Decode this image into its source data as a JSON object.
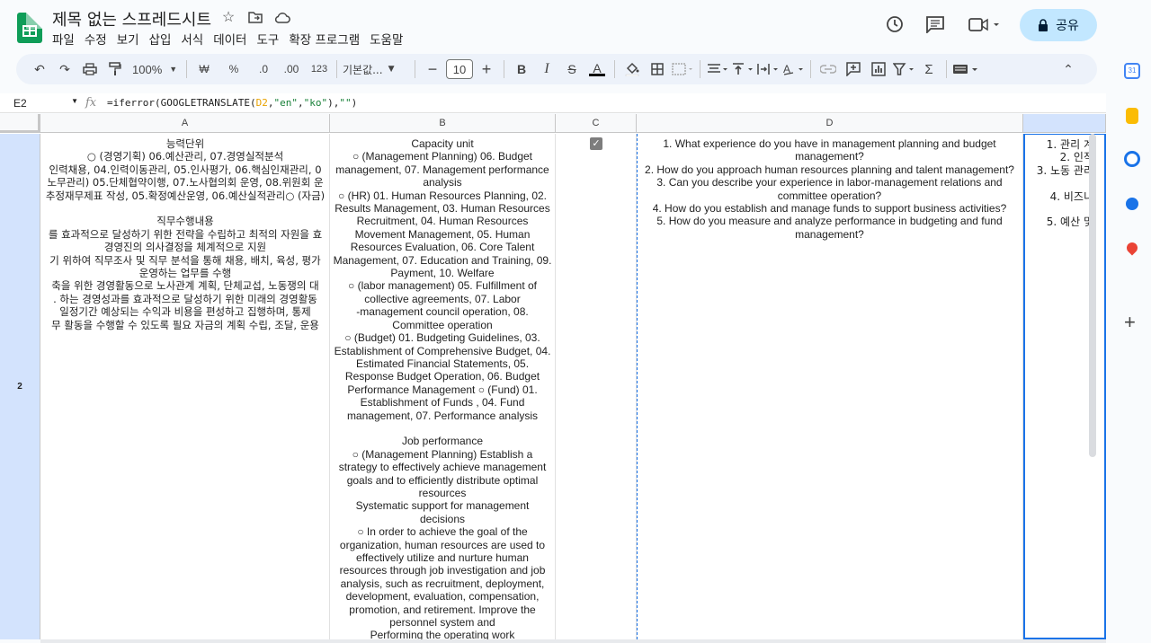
{
  "title": "제목 없는 스프레드시트",
  "menu": [
    "파일",
    "수정",
    "보기",
    "삽입",
    "서식",
    "데이터",
    "도구",
    "확장 프로그램",
    "도움말"
  ],
  "share_label": "공유",
  "toolbar": {
    "zoom": "100%",
    "currency": "₩",
    "percent": "%",
    "dec_decrease": ".0",
    "dec_increase": ".00",
    "more_formats": "123",
    "font": "기본값...",
    "font_size": "10"
  },
  "formula_bar": {
    "cell_ref": "E2",
    "fx": "fx",
    "formula_prefix": "=iferror(GOOGLETRANSLATE(",
    "formula_ref": "D2",
    "formula_mid1": ",",
    "formula_str1": "\"en\"",
    "formula_mid2": ",",
    "formula_str2": "\"ko\"",
    "formula_mid3": "),",
    "formula_str3": "\"\"",
    "formula_end": ")"
  },
  "columns": [
    "A",
    "B",
    "C",
    "D"
  ],
  "row_number": "2",
  "cell_a": [
    "능력단위",
    "○ (경영기획) 06.예산관리, 07.경영실적분석",
    "인력채용, 04.인력이동관리, 05.인사평가, 06.핵심인재관리, 0",
    "노무관리) 05.단체협약이행, 07.노사협의회 운영, 08.위원회 운",
    "추정재무제표 작성, 05.확정예산운영, 06.예산실적관리○ (자금)",
    "",
    "직무수행내용",
    "를 효과적으로 달성하기 위한 전략을 수립하고 최적의 자원을 효",
    "경영진의 의사결정을 체계적으로 지원",
    "기 위하여 직무조사 및 직무 분석을 통해 채용, 배치, 육성, 평가",
    "운영하는 업무를 수행",
    "축을 위한 경영활동으로 노사관계 계획, 단체교섭, 노동쟁의 대",
    ". 하는 경영성과를 효과적으로 달성하기 위한 미래의 경영활동",
    "일정기간 예상되는 수익과 비용을 편성하고 집행하며, 통제",
    "무 활동을 수행할 수 있도록 필요 자금의 계획 수립, 조달, 운용"
  ],
  "cell_b": [
    "Capacity unit",
    "○ (Management Planning) 06. Budget",
    "management, 07. Management performance",
    "analysis",
    "○ (HR) 01. Human Resources Planning, 02.",
    "Results Management, 03. Human Resources",
    "Recruitment, 04. Human Resources",
    "Movement Management, 05. Human",
    "Resources Evaluation, 06. Core Talent",
    "Management, 07. Education and Training, 09.",
    "Payment, 10. Welfare",
    "○ (labor management) 05. Fulfillment of",
    "collective agreements, 07. Labor",
    "-management council operation, 08.",
    "Committee operation",
    "○ (Budget) 01. Budgeting Guidelines, 03.",
    "Establishment of Comprehensive Budget, 04.",
    "Estimated Financial Statements, 05.",
    "Response Budget Operation, 06. Budget",
    "Performance Management ○ (Fund) 01.",
    "Establishment of Funds , 04. Fund",
    "management, 07. Performance analysis",
    "",
    "Job performance",
    "○ (Management Planning) Establish a",
    "strategy to effectively achieve management",
    "goals and to efficiently distribute optimal",
    "resources",
    "Systematic support for management",
    "decisions",
    "○ In order to achieve the goal of the",
    "organization, human resources are used to",
    "effectively utilize and nurture human",
    "resources through job investigation and job",
    "analysis, such as recruitment, deployment,",
    "development, evaluation, compensation,",
    "promotion, and retirement. Improve the",
    "personnel system and",
    "Performing the operating work"
  ],
  "cell_d": [
    "1. What experience do you have in management planning and budget",
    "management?",
    "2. How do you approach human resources planning and talent management?",
    "3. Can you describe your experience in labor-management relations and",
    "committee operation?",
    "4. How do you establish and manage funds to support business activities?",
    "5. How do you measure and analyze performance in budgeting and fund",
    "management?"
  ],
  "cell_e": [
    "1. 관리 계",
    "2. 인적",
    "3. 노동 관리",
    "",
    "4. 비즈니",
    "",
    "5. 예산 및"
  ]
}
